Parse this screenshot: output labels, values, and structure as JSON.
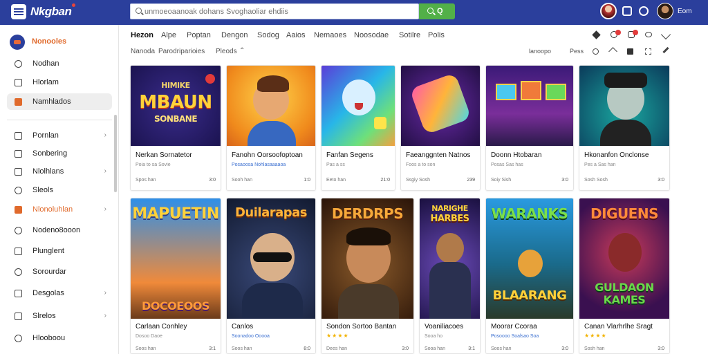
{
  "app": {
    "name": "Nkgban",
    "user": "Eom"
  },
  "search": {
    "placeholder": "unmoeoaanoak dohans Svoghaoliar ehdiis",
    "button": "Q"
  },
  "sidebar": {
    "header": "Nonooles",
    "items": [
      {
        "label": "Nodhan",
        "chevron": ""
      },
      {
        "label": "Hlorlam",
        "chevron": ""
      },
      {
        "label": "Namhlados",
        "chevron": "",
        "active": true
      },
      {
        "label": "Pornlan",
        "chevron": "›"
      },
      {
        "label": "Sonbering",
        "chevron": ""
      },
      {
        "label": "Nlolhlans",
        "chevron": "›"
      },
      {
        "label": "Sleols",
        "chevron": ""
      },
      {
        "label": "Nlonoluhlan",
        "chevron": "›",
        "orange": true
      },
      {
        "label": "Nodeno8ooon",
        "chevron": ""
      },
      {
        "label": "Plunglent",
        "chevron": ""
      },
      {
        "label": "Sorourdar",
        "chevron": ""
      },
      {
        "label": "Desgolas",
        "chevron": "›"
      },
      {
        "label": "Slrelos",
        "chevron": "›"
      },
      {
        "label": "Hlooboou",
        "chevron": ""
      }
    ]
  },
  "tabs": [
    "Hezon",
    "Alpe",
    "Poptan",
    "Dengon",
    "Sodog",
    "Aaios",
    "Nemaoes",
    "Noosodae",
    "Sotilre",
    "Polis"
  ],
  "filters": [
    "Nanoda",
    "Parodriparioies",
    "Pleods",
    "⌃"
  ],
  "toolbar": {
    "sort_a": "lanoopo",
    "sort_b": "Pess"
  },
  "cards_row1": [
    {
      "banner": "MBAUN",
      "banner_top": "HIMIKE",
      "banner_sub": "SONBANE",
      "title": "Nerkan Sornatetor",
      "sub": "Poia to sa Sovie",
      "meta": "Spos han",
      "count": "3:0"
    },
    {
      "banner": "",
      "title": "Fanohn Oorsoofoptoan",
      "sub": "Posaoosa Nohlasaaaaoa",
      "meta": "Sooh han",
      "count": "1:0"
    },
    {
      "banner": "",
      "title": "Fanfan Segens",
      "sub": "Pas a ss",
      "meta": "Eeto han",
      "count": "21:0"
    },
    {
      "banner": "",
      "title": "Faeanggnten Natnos",
      "sub": "Foos a to son",
      "meta": "Ssgiy Sosh",
      "count": "239"
    },
    {
      "banner": "",
      "title": "Doonn Htobaran",
      "sub": "Posas Sas has",
      "meta": "Soiy Sish",
      "count": "3:0"
    },
    {
      "banner": "",
      "title": "Hkonanfon Onclonse",
      "sub": "Pes a Sas han",
      "meta": "Sosh Sosh",
      "count": "3:0"
    }
  ],
  "cards_row2": [
    {
      "banner": "MAPUETIN",
      "banner_sub": "DOCOEOOS",
      "title": "Carlaan Conhley",
      "sub": "Dosoo Daoe",
      "meta": "Soos han",
      "count": "3:1",
      "stars": ""
    },
    {
      "banner": "Duilarapas",
      "banner_sub": "",
      "title": "Canlos",
      "sub": "Soonadoo Ooooa",
      "meta": "Soos han",
      "count": "8:0",
      "stars": ""
    },
    {
      "banner": "DERDRPS",
      "banner_sub": "",
      "title": "Sondon Sortoo Bantan",
      "sub": "",
      "meta": "Dees han",
      "count": "3:0",
      "stars": "★★★★"
    },
    {
      "banner": "NARIGHE",
      "banner_sub": "HARBES",
      "title": "Voaniliacoes",
      "sub": "Sooa ho",
      "meta": "Sooa han",
      "count": "3:1",
      "stars": ""
    },
    {
      "banner": "WARANKS",
      "banner_sub": "BLAARANG",
      "title": "Moorar Ccoraa",
      "sub": "Posoooo Soalsao Soa",
      "meta": "Soos han",
      "count": "3:0",
      "stars": ""
    },
    {
      "banner": "DIGUENS",
      "banner_sub": "GULDAON KAMES",
      "title": "Canan Vlarhrlhe Sragt",
      "sub": "",
      "meta": "Sosh han",
      "count": "3:0",
      "stars": "★★★★"
    }
  ],
  "colors": {
    "topbar": "#2b3f9c",
    "accent": "#e06a2c",
    "search_button": "#52b048"
  }
}
